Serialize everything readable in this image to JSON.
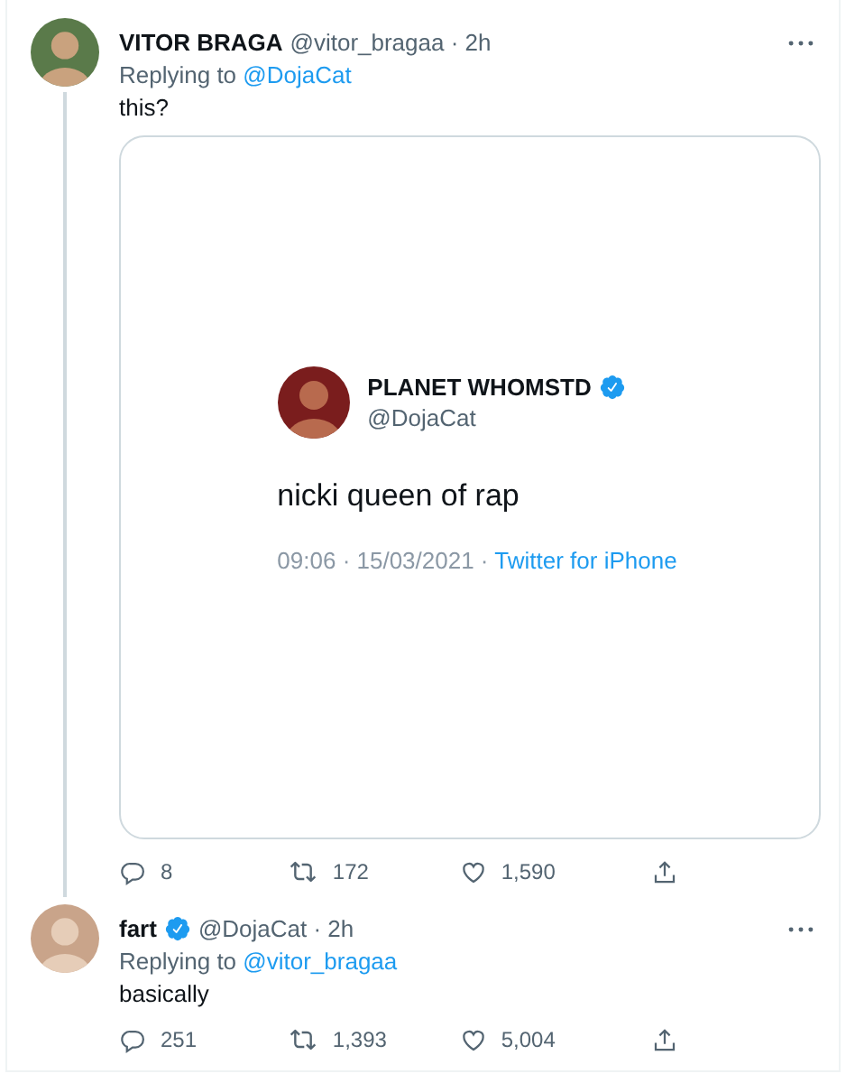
{
  "tweets": [
    {
      "name": "VITOR BRAGA",
      "verified": false,
      "meta": "@vitor_bragaa · 2h",
      "replying_prefix": "Replying to",
      "reply_to": "@DojaCat",
      "text": "this?",
      "thread_line": true,
      "media": {
        "kind": "tweet-screenshot",
        "name": "PLANET WHOMSTD",
        "verified": true,
        "handle": "@DojaCat",
        "text": "nicki queen of rap",
        "date": "09:06 · 15/03/2021 ·",
        "source": "Twitter for iPhone"
      },
      "actions": {
        "replies": "8",
        "retweets": "172",
        "likes": "1,590"
      }
    },
    {
      "name": "fart",
      "verified": true,
      "meta": "@DojaCat · 2h",
      "replying_prefix": "Replying to",
      "reply_to": "@vitor_bragaa",
      "text": "basically",
      "thread_line": false,
      "actions": {
        "replies": "251",
        "retweets": "1,393",
        "likes": "5,004"
      }
    }
  ]
}
